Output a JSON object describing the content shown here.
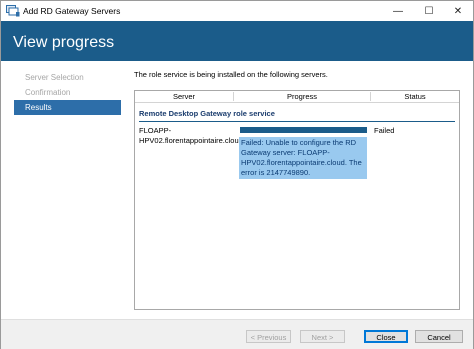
{
  "window": {
    "title": "Add RD Gateway Servers",
    "controls": {
      "minimize": "—",
      "maximize": "☐",
      "close": "✕"
    }
  },
  "header": {
    "title": "View progress"
  },
  "nav": {
    "items": [
      {
        "label": "Server Selection",
        "state": "disabled"
      },
      {
        "label": "Confirmation",
        "state": "disabled"
      },
      {
        "label": "Results",
        "state": "active"
      }
    ]
  },
  "main": {
    "intro": "The role service is being installed on the following servers.",
    "table": {
      "columns": [
        "Server",
        "Progress",
        "Status"
      ],
      "group_title": "Remote Desktop Gateway role service",
      "rows": [
        {
          "server": "FLOAPP-HPV02.florentappointaire.cloud",
          "progress": 1.0,
          "status": "Failed",
          "error": "Failed: Unable to configure the RD Gateway server: FLOAPP-HPV02.florentappointaire.cloud. The error is 2147749890."
        }
      ]
    }
  },
  "footer": {
    "previous_label": "< Previous",
    "next_label": "Next >",
    "close_label": "Close",
    "cancel_label": "Cancel"
  },
  "colors": {
    "header_bg": "#1b5c8a",
    "nav_active": "#2d6ea9",
    "progress_fill": "#1b5c8a",
    "error_highlight": "#99c9ef"
  }
}
